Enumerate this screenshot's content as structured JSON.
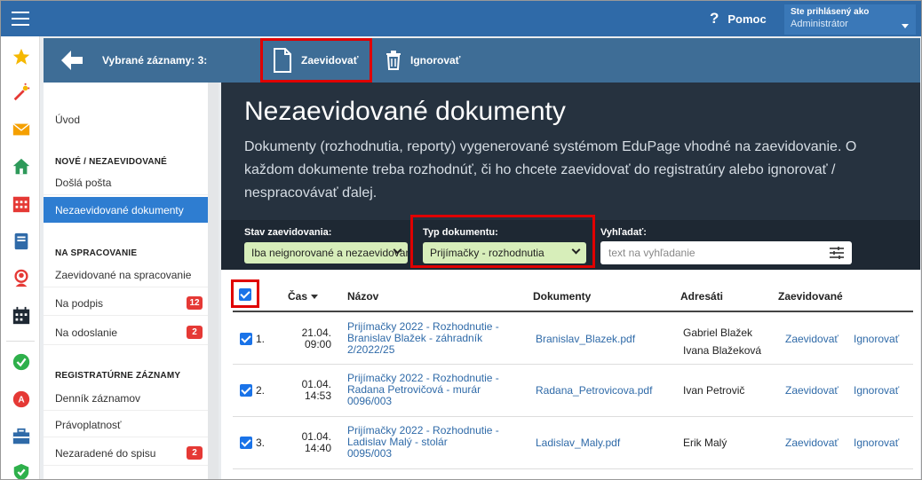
{
  "topbar": {
    "help_label": "Pomoc",
    "user_label": "Ste prihlásený ako",
    "user_role": "Administrátor"
  },
  "actionbar": {
    "selected_label": "Vybrané záznamy: 3:",
    "evid_label": "Zaevidovať",
    "ignore_label": "Ignorovať"
  },
  "sidebar": {
    "intro": "Úvod",
    "section1": "NOVÉ / NEZAEVIDOVANÉ",
    "item_incoming": "Došlá pošta",
    "item_unregistered": "Nezaevidované dokumenty",
    "section2": "NA SPRACOVANIE",
    "item_processing": "Zaevidované na spracovanie",
    "item_sign": "Na podpis",
    "sign_count": "12",
    "item_send": "Na odoslanie",
    "send_count": "2",
    "section3": "REGISTRATÚRNE ZÁZNAMY",
    "item_diary": "Denník záznamov",
    "item_validity": "Právoplatnosť",
    "item_unfiled": "Nezaradené do spisu",
    "unfiled_count": "2"
  },
  "hero": {
    "title": "Nezaevidované dokumenty",
    "description": "Dokumenty (rozhodnutia, reporty) vygenerované systémom EduPage vhodné na zaevidovanie. O každom dokumente treba rozhodnúť, či ho chcete zaevidovať do registratúry alebo ignorovať / nespracovávať ďalej."
  },
  "filters": {
    "status_label": "Stav zaevidovania:",
    "status_value": "Iba neignorované a nezaevidované",
    "type_label": "Typ dokumentu:",
    "type_value": "Prijímačky - rozhodnutia",
    "search_label": "Vyhľadať:",
    "search_placeholder": "text na vyhľadanie"
  },
  "table": {
    "col_time": "Čas",
    "col_name": "Názov",
    "col_docs": "Dokumenty",
    "col_recipients": "Adresáti",
    "col_registered": "Zaevidované",
    "rows": [
      {
        "num": "1.",
        "date": "21.04.",
        "time": "09:00",
        "title1": "Prijímačky 2022 - Rozhodnutie -",
        "title2": "Branislav Blažek - záhradník",
        "title3": "2/2022/25",
        "doc": "Branislav_Blazek.pdf",
        "recipient1": "Gabriel Blažek",
        "recipient2": "Ivana Blažeková",
        "action1": "Zaevidovať",
        "action2": "Ignorovať"
      },
      {
        "num": "2.",
        "date": "01.04.",
        "time": "14:53",
        "title1": "Prijímačky 2022 - Rozhodnutie -",
        "title2": "Radana Petrovičová - murár",
        "title3": "0096/003",
        "doc": "Radana_Petrovicova.pdf",
        "recipient1": "Ivan Petrovič",
        "recipient2": "",
        "action1": "Zaevidovať",
        "action2": "Ignorovať"
      },
      {
        "num": "3.",
        "date": "01.04.",
        "time": "14:40",
        "title1": "Prijímačky 2022 - Rozhodnutie -",
        "title2": "Ladislav Malý - stolár",
        "title3": "0095/003",
        "doc": "Ladislav_Maly.pdf",
        "recipient1": "Erik Malý",
        "recipient2": "",
        "action1": "Zaevidovať",
        "action2": "Ignorovať"
      }
    ]
  },
  "colors": {
    "accent": "#2f6aa8",
    "highlight": "#e00000",
    "filter_bg": "#d7eeba"
  }
}
